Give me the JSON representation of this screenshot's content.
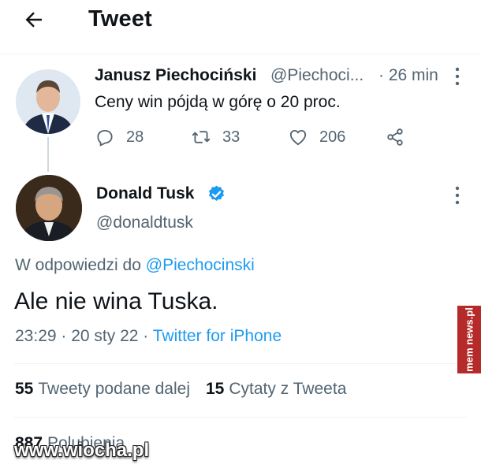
{
  "header": {
    "title": "Tweet"
  },
  "parent_tweet": {
    "name": "Janusz Piechociński",
    "handle": "@Piechoci...",
    "time": "· 26 min",
    "text": "Ceny win pójdą w górę o 20 proc.",
    "replies": "28",
    "retweets": "33",
    "likes": "206"
  },
  "tweet": {
    "name": "Donald Tusk",
    "handle": "@donaldtusk",
    "reply_to_prefix": "W odpowiedzi do",
    "reply_to_mention": "@Piechocinski",
    "text": "Ale nie wina Tuska.",
    "datetime": "23:29 · 20 sty 22 ·",
    "source": "Twitter for iPhone",
    "retweet_count": "55",
    "retweet_label": "Tweety podane dalej",
    "quote_count": "15",
    "quote_label": "Cytaty z Tweeta",
    "like_count": "887",
    "like_label": "Polubienia"
  },
  "watermarks": {
    "side": "mem news.pl",
    "bottom": "www.wiocha.pl"
  },
  "colors": {
    "accent": "#1d9bf0",
    "secondary_text": "#536471",
    "verified": "#1d9bf0"
  }
}
